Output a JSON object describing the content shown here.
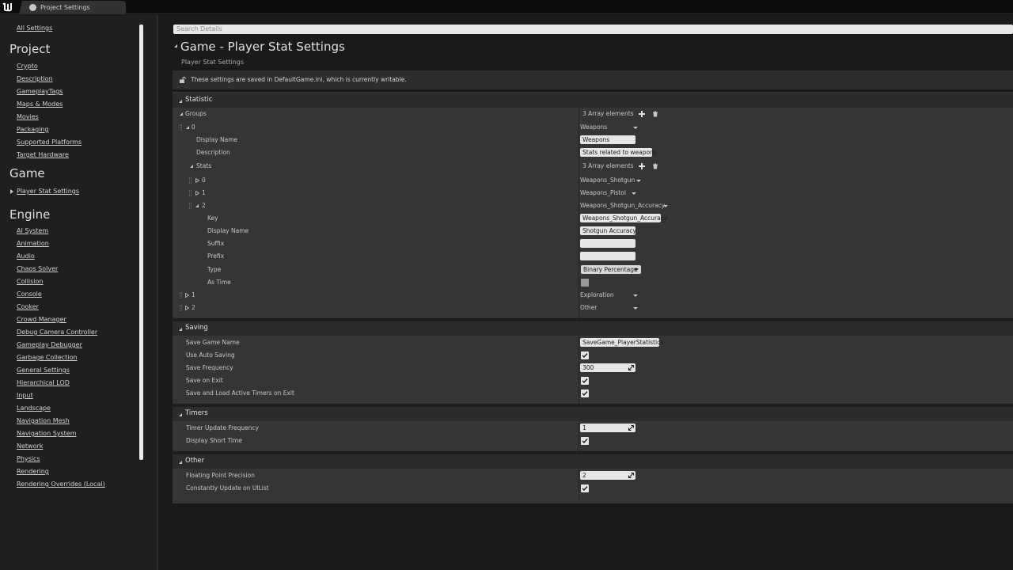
{
  "tab": {
    "label": "Project Settings"
  },
  "sidebar": {
    "all_settings": "All Settings",
    "project_header": "Project",
    "project_items": [
      "Crypto",
      "Description",
      "GameplayTags",
      "Maps & Modes",
      "Movies",
      "Packaging",
      "Supported Platforms",
      "Target Hardware"
    ],
    "game_header": "Game",
    "game_items": [
      "Player Stat Settings"
    ],
    "engine_header": "Engine",
    "engine_items": [
      "AI System",
      "Animation",
      "Audio",
      "Chaos Solver",
      "Collision",
      "Console",
      "Cooker",
      "Crowd Manager",
      "Debug Camera Controller",
      "Gameplay Debugger",
      "Garbage Collection",
      "General Settings",
      "Hierarchical LOD",
      "Input",
      "Landscape",
      "Navigation Mesh",
      "Navigation System",
      "Network",
      "Physics",
      "Rendering",
      "Rendering Overrides (Local)"
    ]
  },
  "main": {
    "search_placeholder": "Search Details",
    "title": "Game - Player Stat Settings",
    "subtitle": "Player Stat Settings",
    "notice": "These settings are saved in DefaultGame.ini, which is currently writable."
  },
  "statistic": {
    "category": "Statistic",
    "groups_label": "Groups",
    "groups_value": "3 Array elements",
    "g0_index": "0",
    "g0_value": "Weapons",
    "display_name_label": "Display Name",
    "display_name_value": "Weapons",
    "description_label": "Description",
    "description_value": "Stats related to weapons",
    "stats_label": "Stats",
    "stats_value": "3 Array elements",
    "s0_index": "0",
    "s0_value": "Weapons_Shotgun",
    "s1_index": "1",
    "s1_value": "Weapons_Pistol",
    "s2_index": "2",
    "s2_value": "Weapons_Shotgun_Accuracy",
    "key_label": "Key",
    "key_value": "Weapons_Shotgun_Accuracy",
    "s2_display_label": "Display Name",
    "s2_display_value": "Shotgun Accuracy",
    "suffix_label": "Suffix",
    "suffix_value": "",
    "prefix_label": "Prefix",
    "prefix_value": "",
    "type_label": "Type",
    "type_value": "Binary Percentage",
    "as_time_label": "As Time",
    "as_time_checked": false,
    "g1_index": "1",
    "g1_value": "Exploration",
    "g2_index": "2",
    "g2_value": "Other"
  },
  "saving": {
    "category": "Saving",
    "save_game_name_label": "Save Game Name",
    "save_game_name_value": "SaveGame_PlayerStatistics",
    "auto_saving_label": "Use Auto Saving",
    "auto_saving_checked": true,
    "frequency_label": "Save Frequency",
    "frequency_value": "300",
    "save_on_exit_label": "Save on Exit",
    "save_on_exit_checked": true,
    "save_timers_label": "Save and Load Active Timers on Exit",
    "save_timers_checked": true
  },
  "timers": {
    "category": "Timers",
    "update_freq_label": "Timer Update Frequency",
    "update_freq_value": "1",
    "short_time_label": "Display Short Time",
    "short_time_checked": true
  },
  "other": {
    "category": "Other",
    "precision_label": "Floating Point Precision",
    "precision_value": "2",
    "constantly_update_label": "Constantly Update on UIList",
    "constantly_update_checked": true
  }
}
